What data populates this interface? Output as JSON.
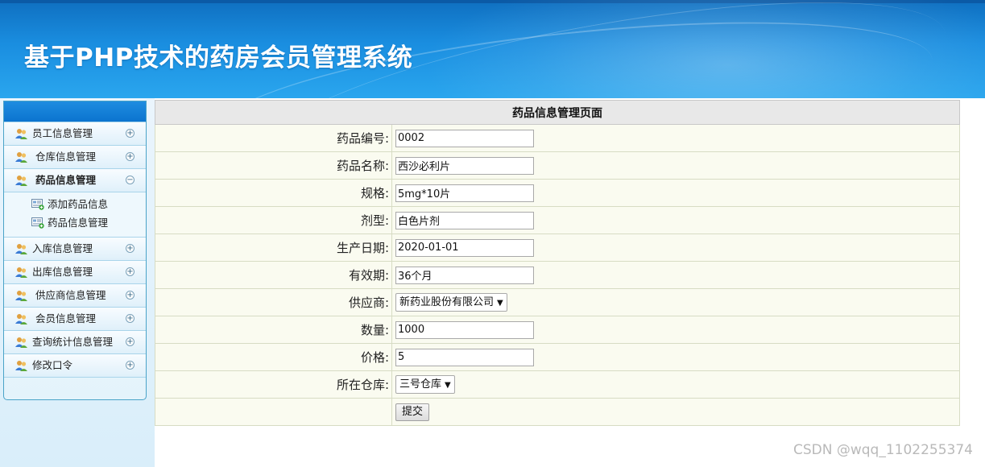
{
  "header": {
    "title": "基于PHP技术的药房会员管理系统"
  },
  "sidebar": {
    "items": [
      {
        "label": "员工信息管理",
        "toggle": "+"
      },
      {
        "label": "仓库信息管理",
        "toggle": "+"
      },
      {
        "label": "药品信息管理",
        "toggle": "−",
        "active": true,
        "children": [
          {
            "label": "添加药品信息"
          },
          {
            "label": "药品信息管理"
          }
        ]
      },
      {
        "label": "入库信息管理",
        "toggle": "+"
      },
      {
        "label": "出库信息管理",
        "toggle": "+"
      },
      {
        "label": "供应商信息管理",
        "toggle": "+"
      },
      {
        "label": "会员信息管理",
        "toggle": "+"
      },
      {
        "label": "查询统计信息管理",
        "toggle": "+"
      },
      {
        "label": "修改口令",
        "toggle": "+"
      }
    ]
  },
  "form": {
    "caption": "药品信息管理页面",
    "fields": {
      "code": {
        "label": "药品编号:",
        "value": "0002"
      },
      "name": {
        "label": "药品名称:",
        "value": "西沙必利片"
      },
      "spec": {
        "label": "规格:",
        "value": "5mg*10片"
      },
      "dosage": {
        "label": "剂型:",
        "value": "白色片剂"
      },
      "mfg_date": {
        "label": "生产日期:",
        "value": "2020-01-01"
      },
      "validity": {
        "label": "有效期:",
        "value": "36个月"
      },
      "supplier": {
        "label": "供应商:",
        "selected": "新药业股份有限公司"
      },
      "quantity": {
        "label": "数量:",
        "value": "1000"
      },
      "price": {
        "label": "价格:",
        "value": "5"
      },
      "warehouse": {
        "label": "所在仓库:",
        "selected": "三号仓库"
      }
    },
    "submit_label": "提交"
  },
  "watermark": "CSDN @wqq_1102255374",
  "colors": {
    "header_blue": "#1a8ee0",
    "sidebar_head": "#0b74cf",
    "form_bg": "#fafbf0",
    "caption_bg": "#e8e8e8"
  }
}
